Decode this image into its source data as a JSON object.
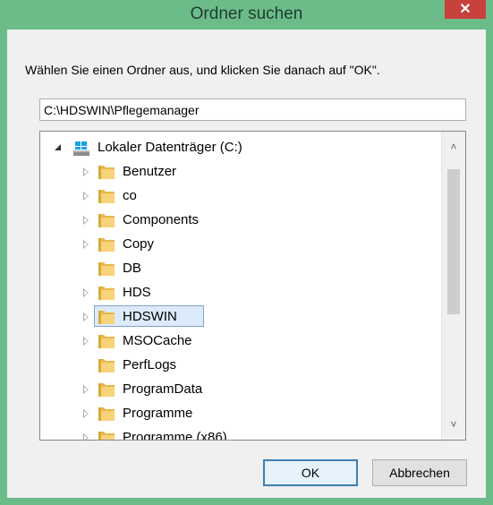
{
  "window": {
    "title": "Ordner suchen",
    "close_label": "✕"
  },
  "instruction": "Wählen Sie einen Ordner aus, und klicken Sie danach auf \"OK\".",
  "path_field": {
    "value": "C:\\HDSWIN\\Pflegemanager"
  },
  "tree": {
    "root": {
      "label": "Lokaler Datenträger (C:)",
      "icon": "drive-icon",
      "expanded": true
    },
    "items": [
      {
        "label": "Benutzer",
        "has_children": true
      },
      {
        "label": "co",
        "has_children": true
      },
      {
        "label": "Components",
        "has_children": true
      },
      {
        "label": "Copy",
        "has_children": true
      },
      {
        "label": "DB",
        "has_children": false
      },
      {
        "label": "HDS",
        "has_children": true
      },
      {
        "label": "HDSWIN",
        "has_children": true,
        "selected": true
      },
      {
        "label": "MSOCache",
        "has_children": true
      },
      {
        "label": "PerfLogs",
        "has_children": false
      },
      {
        "label": "ProgramData",
        "has_children": true
      },
      {
        "label": "Programme",
        "has_children": true
      },
      {
        "label": "Programme (x86)",
        "has_children": true
      }
    ]
  },
  "scrollbar": {
    "up_icon": "chevron-up-icon",
    "down_icon": "chevron-down-icon"
  },
  "buttons": {
    "ok": "OK",
    "cancel": "Abbrechen"
  },
  "colors": {
    "frame": "#6cbc8a",
    "close": "#c8413c",
    "selection": "#dcebfc",
    "folder": "#e8b84a"
  }
}
